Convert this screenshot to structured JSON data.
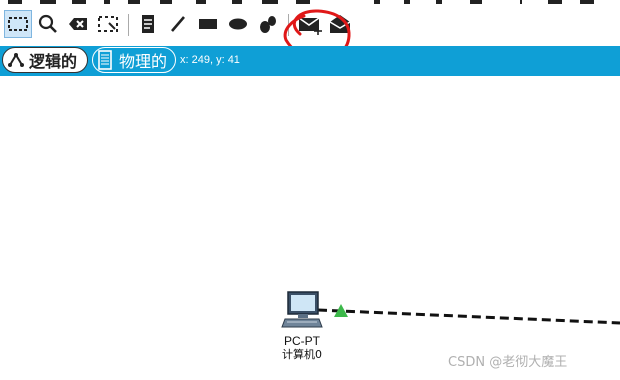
{
  "toolbar": {
    "tools": [
      {
        "icon": "select-icon",
        "active": true
      },
      {
        "icon": "search-icon"
      },
      {
        "icon": "delete-icon"
      },
      {
        "icon": "resize-icon"
      },
      {
        "icon": "note-icon"
      },
      {
        "icon": "line-icon"
      },
      {
        "icon": "rectangle-icon"
      },
      {
        "icon": "ellipse-icon"
      },
      {
        "icon": "freeform-icon"
      },
      {
        "icon": "simple-pdu-icon",
        "highlighted": true
      },
      {
        "icon": "complex-pdu-icon"
      }
    ]
  },
  "tabs": {
    "logical_label": "逻辑的",
    "physical_label": "物理的",
    "coords": "x: 249, y: 41"
  },
  "device": {
    "model": "PC-PT",
    "name": "计算机0",
    "link_status_color": "#3cb84a"
  },
  "watermark": "CSDN @老彻大魔王",
  "colors": {
    "tab_bar": "#0f9fd6",
    "annotation": "#e01818"
  }
}
